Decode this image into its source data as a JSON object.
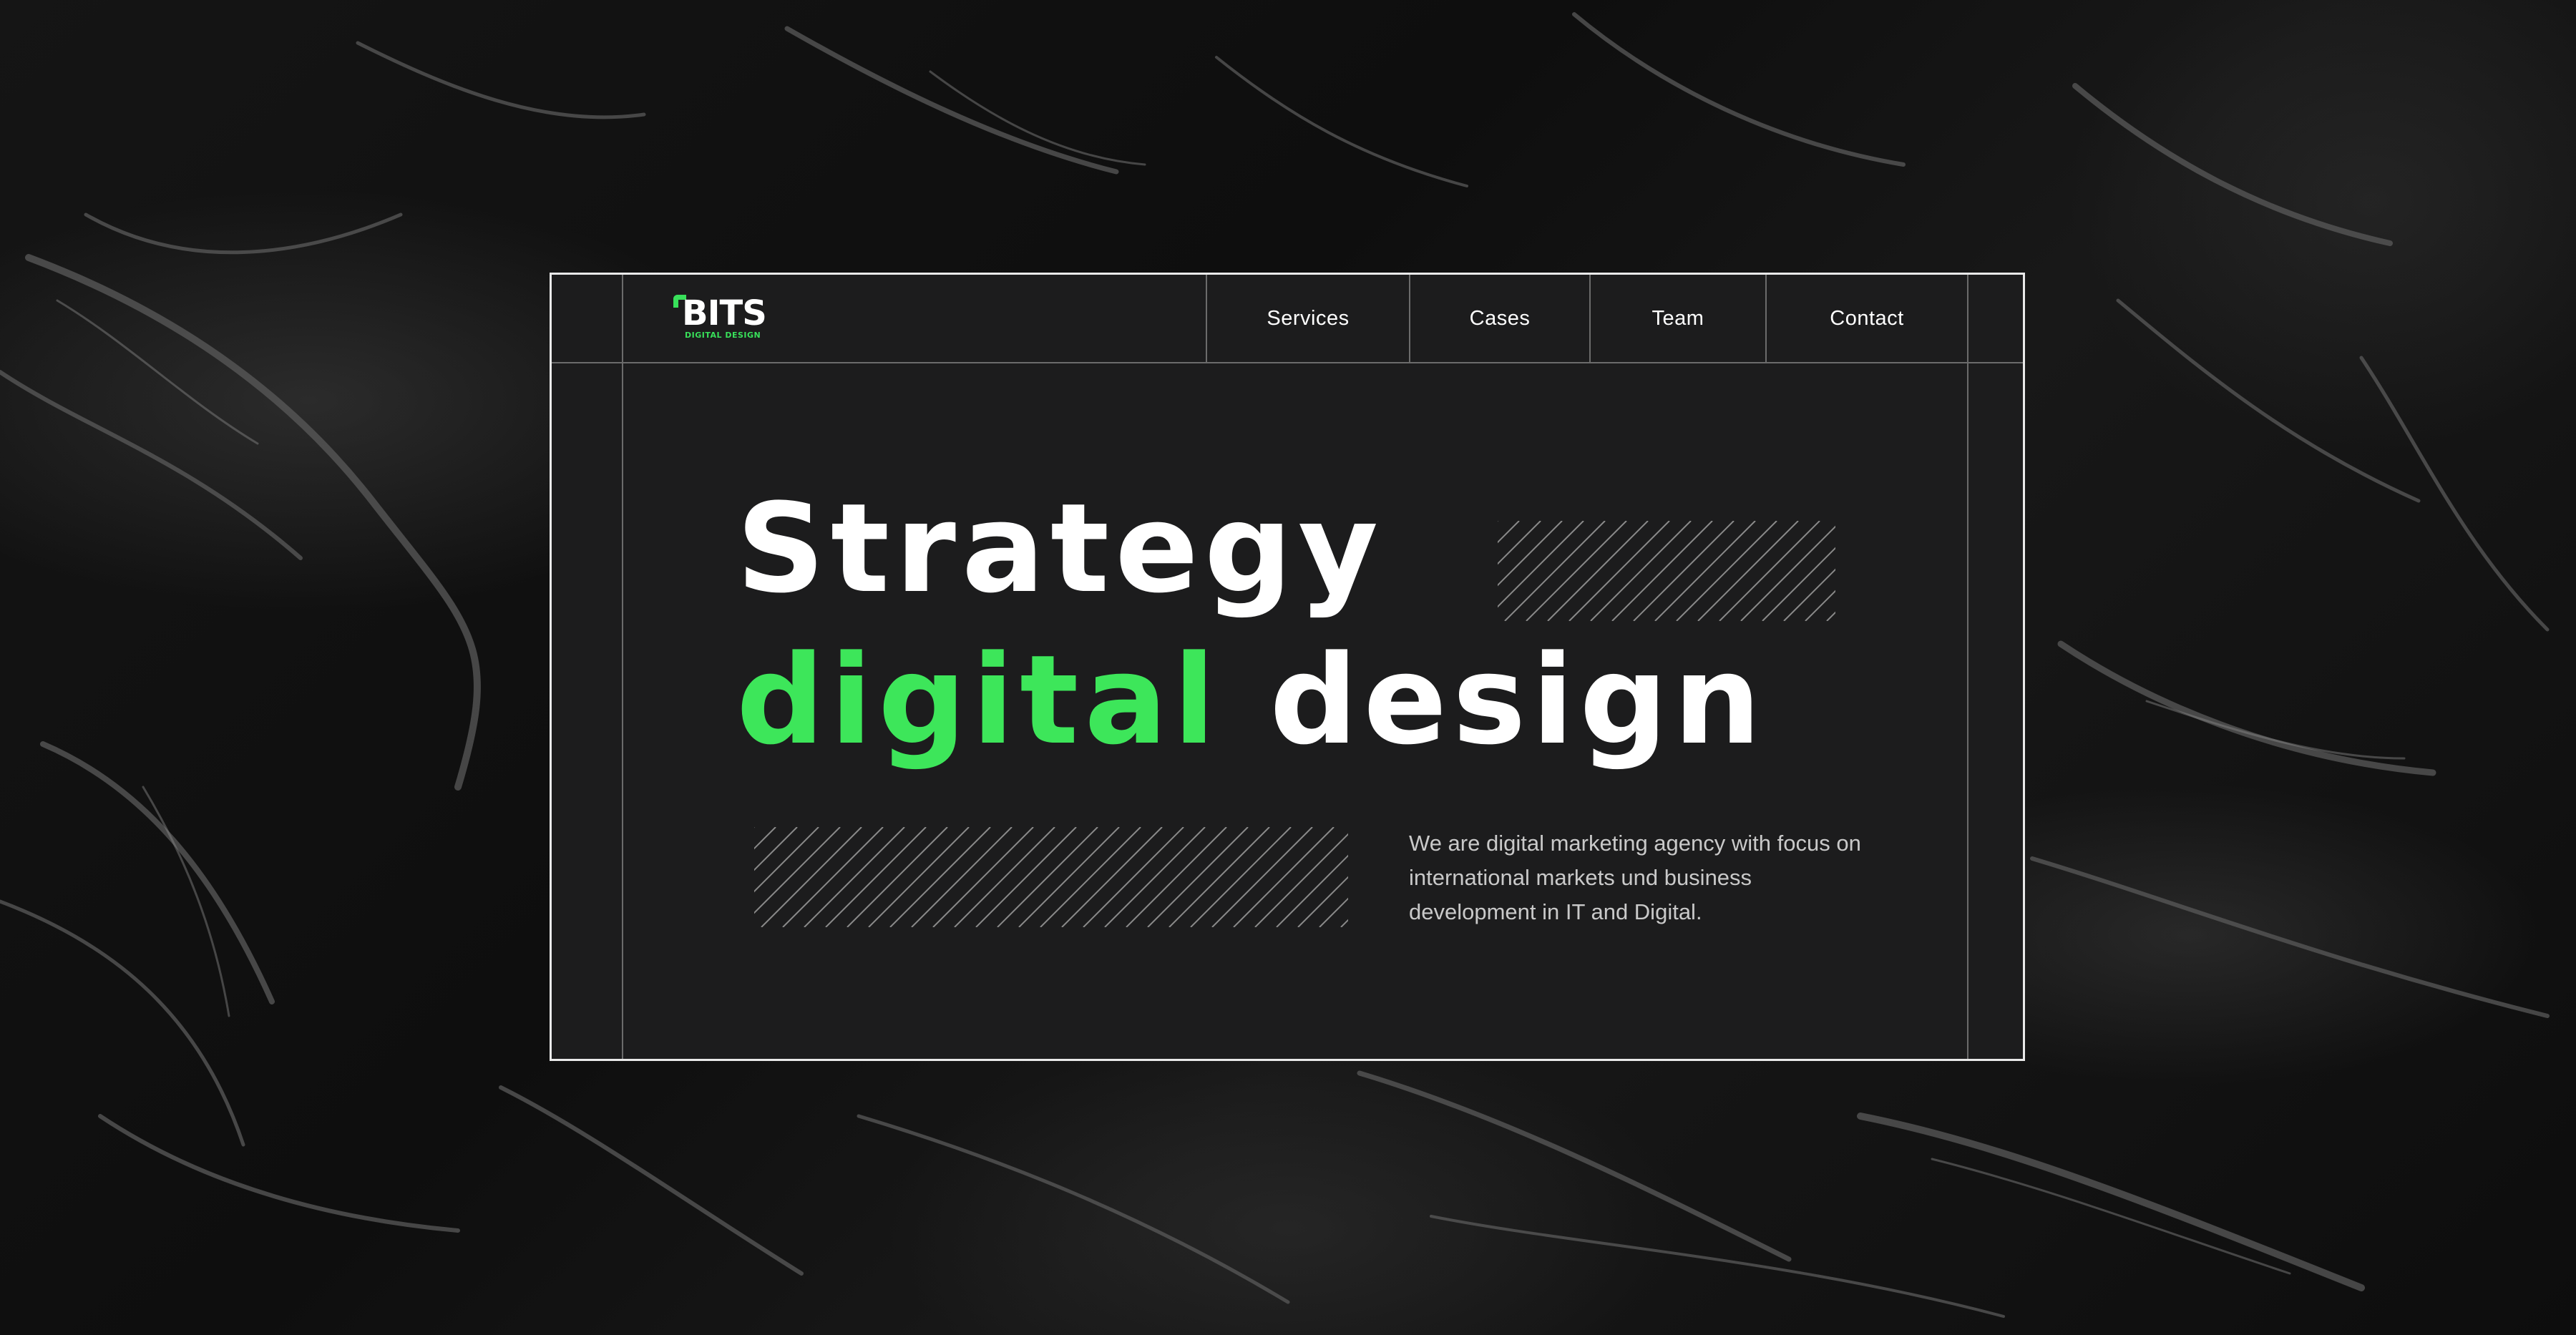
{
  "brand": {
    "name": "BITS",
    "tagline": "DIGITAL DESIGN",
    "accent_color": "#3de65a"
  },
  "nav": {
    "items": [
      {
        "label": "Services"
      },
      {
        "label": "Cases"
      },
      {
        "label": "Team"
      },
      {
        "label": "Contact"
      }
    ]
  },
  "hero": {
    "line1": "Strategy",
    "line2_green": "digital",
    "line2_white": "design",
    "description": "We are digital marketing agency with focus on international markets und business development in IT and Digital."
  },
  "icons": {
    "logo_mark": "bits-logo-mark-icon",
    "hatch": "diagonal-hatch-pattern"
  }
}
